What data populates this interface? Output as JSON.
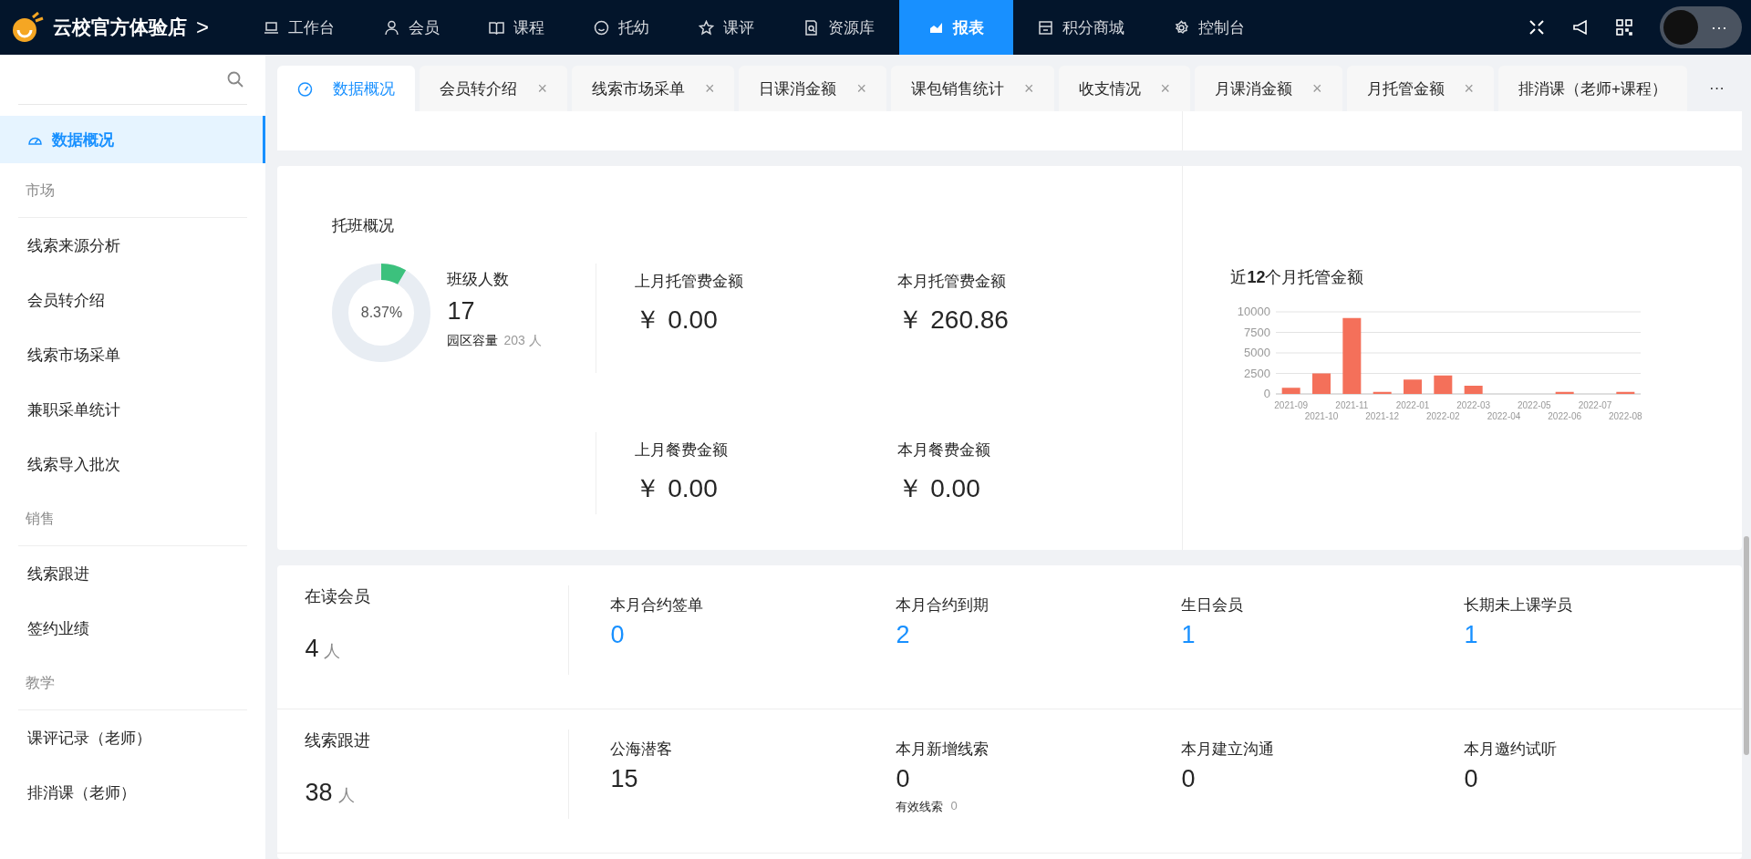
{
  "brand": {
    "name": "云校官方体验店",
    "caret": ">"
  },
  "nav": [
    {
      "label": "工作台",
      "selected": false
    },
    {
      "label": "会员",
      "selected": false
    },
    {
      "label": "课程",
      "selected": false
    },
    {
      "label": "托幼",
      "selected": false
    },
    {
      "label": "课评",
      "selected": false
    },
    {
      "label": "资源库",
      "selected": false
    },
    {
      "label": "报表",
      "selected": true
    },
    {
      "label": "积分商城",
      "selected": false
    },
    {
      "label": "控制台",
      "selected": false
    }
  ],
  "header_more": "···",
  "sidebar": {
    "items": [
      {
        "kind": "item",
        "label": "数据概况",
        "selected": true
      },
      {
        "kind": "group",
        "label": "市场"
      },
      {
        "kind": "item",
        "label": "线索来源分析",
        "selected": false
      },
      {
        "kind": "item",
        "label": "会员转介绍",
        "selected": false
      },
      {
        "kind": "item",
        "label": "线索市场采单",
        "selected": false
      },
      {
        "kind": "item",
        "label": "兼职采单统计",
        "selected": false
      },
      {
        "kind": "item",
        "label": "线索导入批次",
        "selected": false
      },
      {
        "kind": "group",
        "label": "销售"
      },
      {
        "kind": "item",
        "label": "线索跟进",
        "selected": false
      },
      {
        "kind": "item",
        "label": "签约业绩",
        "selected": false
      },
      {
        "kind": "group",
        "label": "教学"
      },
      {
        "kind": "item",
        "label": "课评记录（老师）",
        "selected": false
      },
      {
        "kind": "item",
        "label": "排消课（老师）",
        "selected": false
      }
    ]
  },
  "tabs": {
    "items": [
      {
        "label": "数据概况",
        "selected": true,
        "closable": false
      },
      {
        "label": "会员转介绍",
        "selected": false,
        "closable": true
      },
      {
        "label": "线索市场采单",
        "selected": false,
        "closable": true
      },
      {
        "label": "日课消金额",
        "selected": false,
        "closable": true
      },
      {
        "label": "课包销售统计",
        "selected": false,
        "closable": true
      },
      {
        "label": "收支情况",
        "selected": false,
        "closable": true
      },
      {
        "label": "月课消金额",
        "selected": false,
        "closable": true
      },
      {
        "label": "月托管金额",
        "selected": false,
        "closable": true
      },
      {
        "label": "排消课（老师+课程）",
        "selected": false,
        "closable": false
      }
    ],
    "more": "···",
    "close": "×"
  },
  "daycare": {
    "title": "托班概况",
    "ring": {
      "level": 0.0837,
      "reading": "8.37%"
    },
    "class_size": {
      "label": "班级人数",
      "value": "17",
      "capacity_label": "园区容量",
      "capacity": "203",
      "unit": "人"
    },
    "stats": [
      {
        "label": "上月托管费金额",
        "value": "￥ 0.00"
      },
      {
        "label": "本月托管费金额",
        "value": "￥ 260.86"
      },
      {
        "label": "上月餐费金额",
        "value": "￥ 0.00"
      },
      {
        "label": "本月餐费金额",
        "value": "￥ 0.00"
      }
    ],
    "chart_title": "近**12**个月托管金额",
    "chart_data": {
      "type": "bar",
      "categories": [
        "2021-09",
        "2021-10",
        "2021-11",
        "2021-12",
        "2022-01",
        "2022-02",
        "2022-03",
        "2022-04",
        "2022-05",
        "2022-06",
        "2022-07",
        "2022-08"
      ],
      "series": [
        {
          "color": "#f4705a",
          "values": [
            750,
            2500,
            9250,
            250,
            1750,
            2250,
            1000,
            0,
            0,
            250,
            0,
            250
          ]
        }
      ],
      "ylim": [
        0,
        10000
      ],
      "yticks": [
        0,
        2500,
        5000,
        7500,
        10000
      ],
      "grid": true
    }
  },
  "summary": [
    {
      "title": "在读会员",
      "count": "4",
      "unit": "人",
      "stats": [
        {
          "label": "本月合约签单",
          "value": "0",
          "link": true
        },
        {
          "label": "本月合约到期",
          "value": "2",
          "link": true
        },
        {
          "label": "生日会员",
          "value": "1",
          "link": true
        },
        {
          "label": "长期未上课学员",
          "value": "1",
          "link": true
        }
      ]
    },
    {
      "title": "线索跟进",
      "count": "38",
      "unit": "人",
      "stats": [
        {
          "label": "公海潜客",
          "value": "15",
          "link": false
        },
        {
          "label": "本月新增线索",
          "value": "0",
          "link": false,
          "sub_label": "有效线索",
          "sub_value": "0"
        },
        {
          "label": "本月建立沟通",
          "value": "0",
          "link": false
        },
        {
          "label": "本月邀约试听",
          "value": "0",
          "link": false
        }
      ]
    }
  ]
}
